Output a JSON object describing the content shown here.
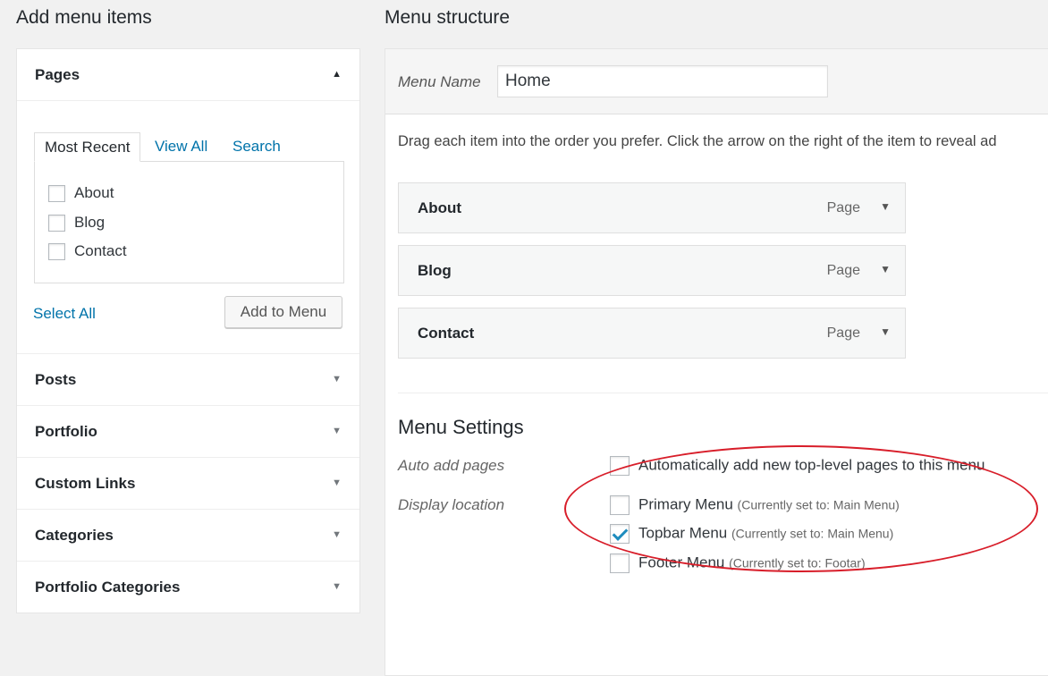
{
  "left": {
    "heading": "Add menu items",
    "pages": {
      "title": "Pages",
      "tabs": [
        "Most Recent",
        "View All",
        "Search"
      ],
      "items": [
        "About",
        "Blog",
        "Contact"
      ],
      "select_all": "Select All",
      "add_button": "Add to Menu"
    },
    "sections": [
      "Posts",
      "Portfolio",
      "Custom Links",
      "Categories",
      "Portfolio Categories"
    ]
  },
  "right": {
    "heading": "Menu structure",
    "menu_name_label": "Menu Name",
    "menu_name_value": "Home",
    "instructions": "Drag each item into the order you prefer. Click the arrow on the right of the item to reveal ad",
    "items": [
      {
        "title": "About",
        "type": "Page"
      },
      {
        "title": "Blog",
        "type": "Page"
      },
      {
        "title": "Contact",
        "type": "Page"
      }
    ],
    "settings": {
      "title": "Menu Settings",
      "auto_add_label": "Auto add pages",
      "auto_add_option": "Automatically add new top-level pages to this menu",
      "display_location_label": "Display location",
      "locations": [
        {
          "name": "Primary Menu",
          "note": "(Currently set to: Main Menu)",
          "checked": false
        },
        {
          "name": "Topbar Menu",
          "note": "(Currently set to: Main Menu)",
          "checked": true
        },
        {
          "name": "Footer Menu",
          "note": "(Currently set to: Footar)",
          "checked": false
        }
      ]
    }
  },
  "colors": {
    "link": "#0073aa",
    "highlight": "#d81e2a",
    "check": "#1e8cbe"
  }
}
